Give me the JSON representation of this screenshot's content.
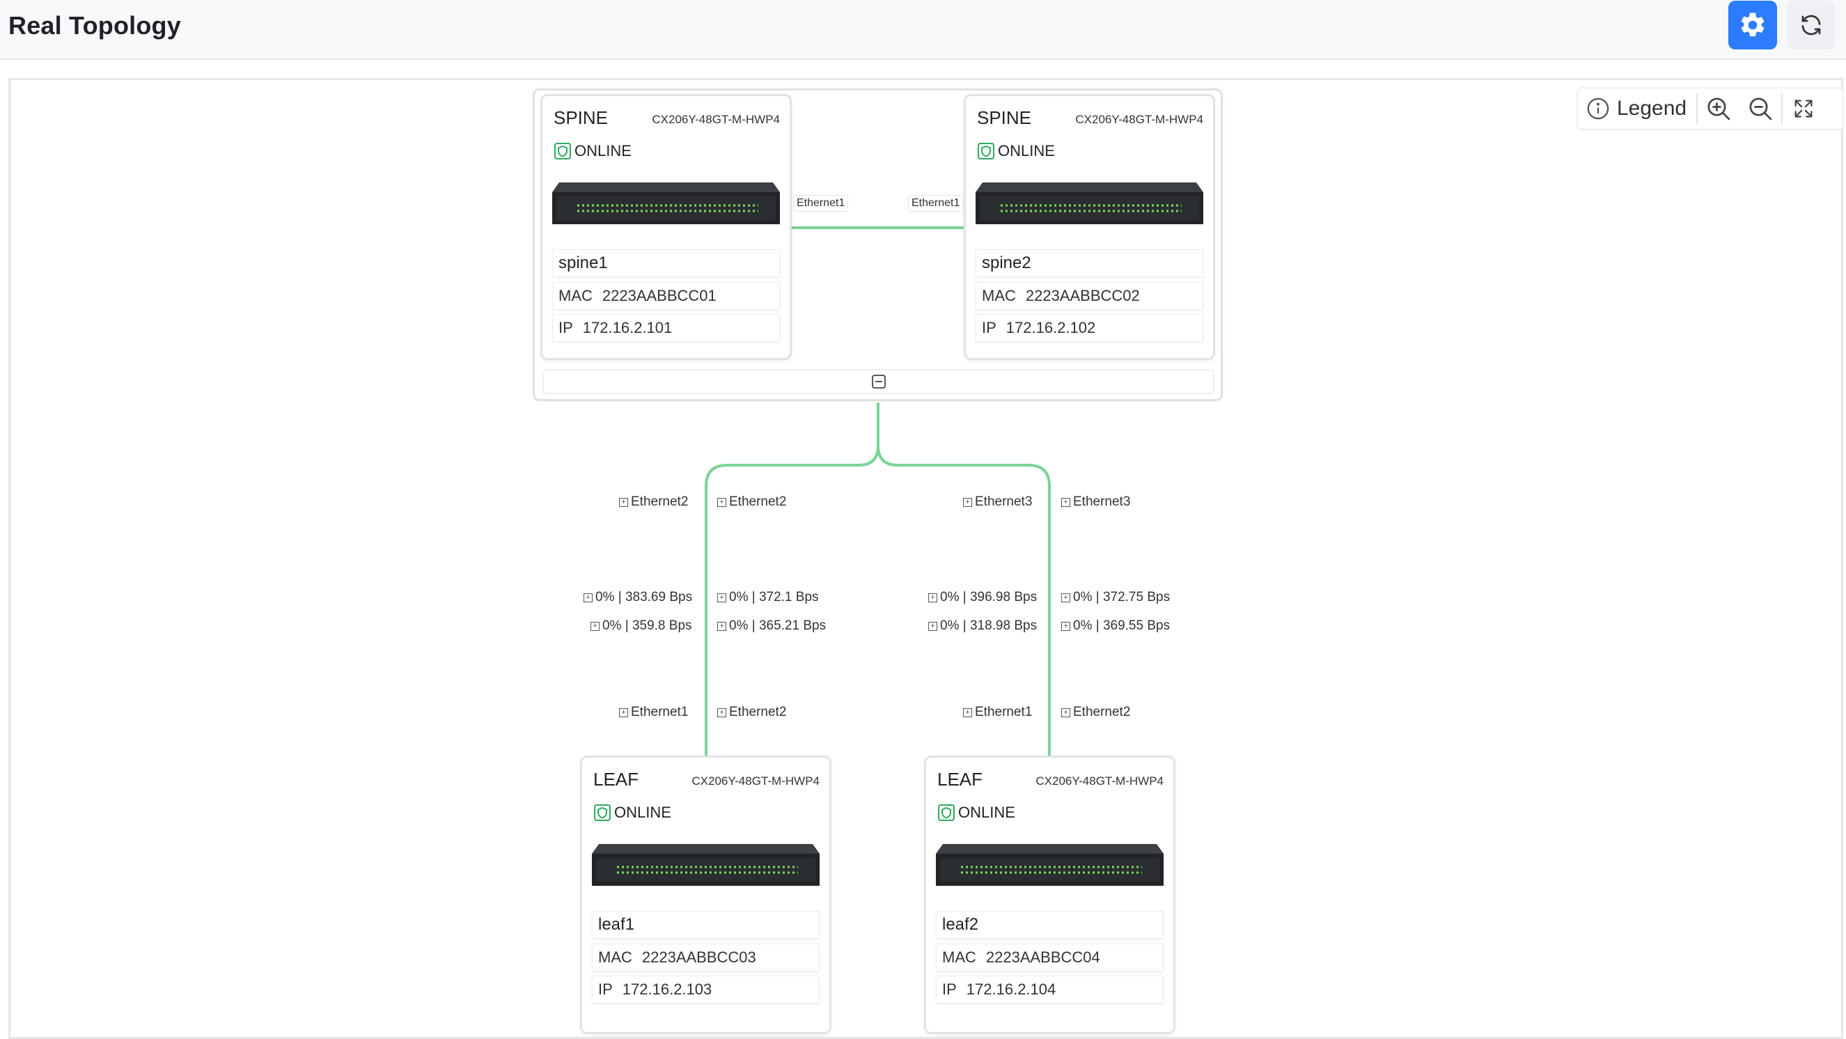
{
  "header": {
    "title": "Real Topology",
    "settings_icon": "gear-icon",
    "refresh_icon": "refresh-icon",
    "accent": "#2b7cff"
  },
  "toolbar": {
    "legend_label": "Legend",
    "legend_icon": "info-icon",
    "zoom_in_icon": "zoom-in-icon",
    "zoom_out_icon": "zoom-out-icon",
    "fullscreen_icon": "fullscreen-icon"
  },
  "colors": {
    "link": "#7bd397",
    "online": "#2eaa5c"
  },
  "devices": {
    "spine1": {
      "role": "SPINE",
      "model": "CX206Y-48GT-M-HWP4",
      "status": "ONLINE",
      "name": "spine1",
      "mac_label": "MAC",
      "mac": "2223AABBCC01",
      "ip_label": "IP",
      "ip": "172.16.2.101"
    },
    "spine2": {
      "role": "SPINE",
      "model": "CX206Y-48GT-M-HWP4",
      "status": "ONLINE",
      "name": "spine2",
      "mac_label": "MAC",
      "mac": "2223AABBCC02",
      "ip_label": "IP",
      "ip": "172.16.2.102"
    },
    "leaf1": {
      "role": "LEAF",
      "model": "CX206Y-48GT-M-HWP4",
      "status": "ONLINE",
      "name": "leaf1",
      "mac_label": "MAC",
      "mac": "2223AABBCC03",
      "ip_label": "IP",
      "ip": "172.16.2.103"
    },
    "leaf2": {
      "role": "LEAF",
      "model": "CX206Y-48GT-M-HWP4",
      "status": "ONLINE",
      "name": "leaf2",
      "mac_label": "MAC",
      "mac": "2223AABBCC04",
      "ip_label": "IP",
      "ip": "172.16.2.104"
    }
  },
  "links": {
    "spine_peer": {
      "a_port": "Ethernet1",
      "b_port": "Ethernet1"
    },
    "leaf1_uplink": {
      "top_left": "Ethernet2",
      "top_right": "Ethernet2",
      "stat_left_1": "0% | 383.69 Bps",
      "stat_left_2": "0% | 359.8 Bps",
      "stat_right_1": "0% | 372.1 Bps",
      "stat_right_2": "0% | 365.21 Bps",
      "bottom_left": "Ethernet1",
      "bottom_right": "Ethernet2"
    },
    "leaf2_uplink": {
      "top_left": "Ethernet3",
      "top_right": "Ethernet3",
      "stat_left_1": "0% | 396.98 Bps",
      "stat_left_2": "0% | 318.98 Bps",
      "stat_right_1": "0% | 372.75 Bps",
      "stat_right_2": "0% | 369.55 Bps",
      "bottom_left": "Ethernet1",
      "bottom_right": "Ethernet2"
    }
  }
}
